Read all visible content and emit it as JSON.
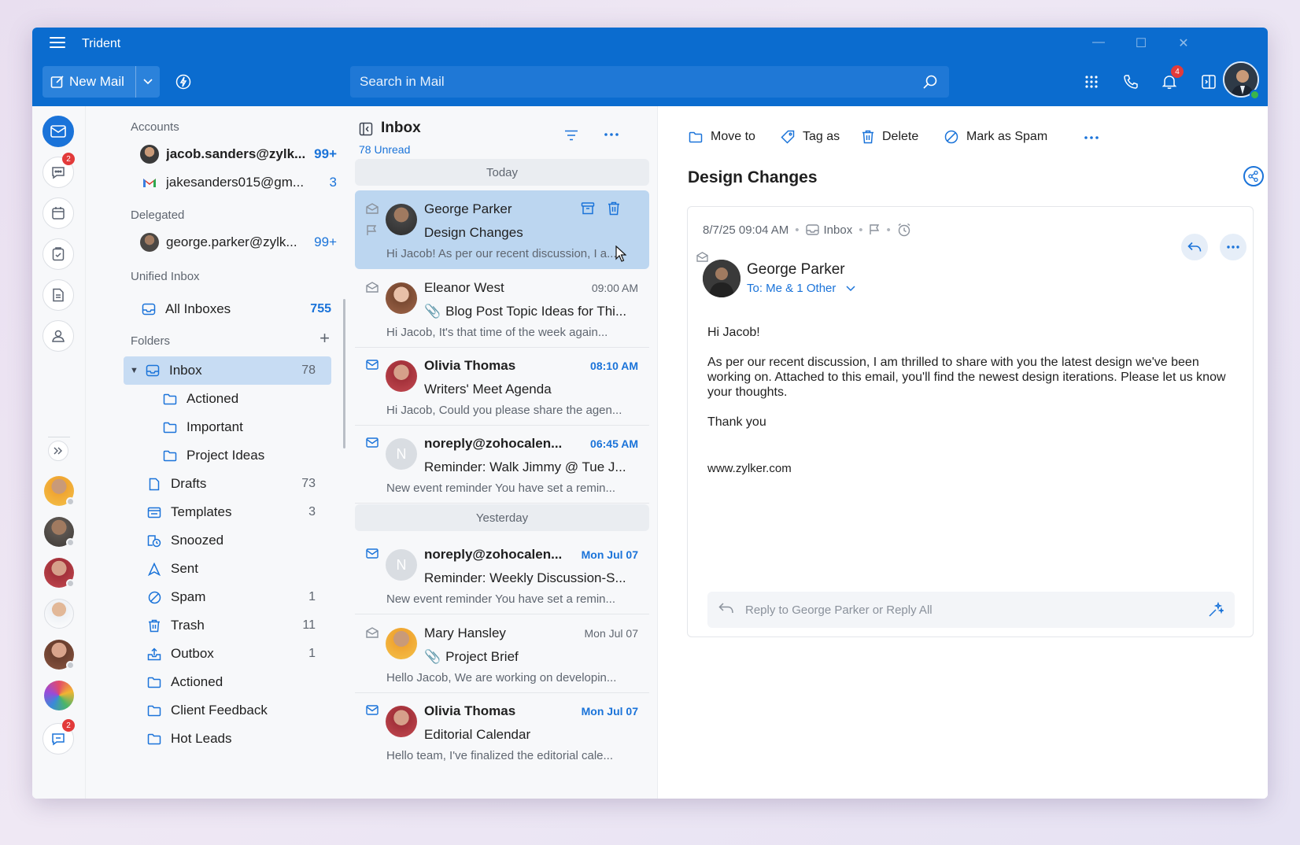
{
  "header": {
    "app_title": "Trident",
    "new_mail_label": "New Mail",
    "search_placeholder": "Search in Mail",
    "notification_count": "4"
  },
  "rail": {
    "chat_badge": "2",
    "bottom_badge": "2"
  },
  "folders": {
    "accounts_title": "Accounts",
    "accounts": [
      {
        "label": "jacob.sanders@zylk...",
        "count": "99+"
      },
      {
        "label": "jakesanders015@gm...",
        "count": "3"
      }
    ],
    "delegated_title": "Delegated",
    "delegated": [
      {
        "label": "george.parker@zylk...",
        "count": "99+"
      }
    ],
    "unified_title": "Unified Inbox",
    "unified": {
      "label": "All Inboxes",
      "count": "755"
    },
    "folders_title": "Folders",
    "items": [
      {
        "label": "Inbox",
        "count": "78"
      },
      {
        "label": "Actioned",
        "count": ""
      },
      {
        "label": "Important",
        "count": ""
      },
      {
        "label": "Project Ideas",
        "count": ""
      },
      {
        "label": "Drafts",
        "count": "73"
      },
      {
        "label": "Templates",
        "count": "3"
      },
      {
        "label": "Snoozed",
        "count": ""
      },
      {
        "label": "Sent",
        "count": ""
      },
      {
        "label": "Spam",
        "count": "1"
      },
      {
        "label": "Trash",
        "count": "11"
      },
      {
        "label": "Outbox",
        "count": "1"
      },
      {
        "label": "Actioned",
        "count": ""
      },
      {
        "label": "Client Feedback",
        "count": ""
      },
      {
        "label": "Hot Leads",
        "count": ""
      }
    ]
  },
  "list": {
    "title": "Inbox",
    "unread": "78 Unread",
    "day_today": "Today",
    "day_yesterday": "Yesterday",
    "messages": [
      {
        "from": "George Parker",
        "time": "",
        "subject": "Design Changes",
        "preview": "Hi Jacob! As per our recent discussion, I a..."
      },
      {
        "from": "Eleanor West",
        "time": "09:00 AM",
        "subject": "Blog Post Topic Ideas for Thi...",
        "preview": "Hi Jacob, It's that time of the week again..."
      },
      {
        "from": "Olivia Thomas",
        "time": "08:10 AM",
        "subject": "Writers' Meet Agenda",
        "preview": "Hi Jacob, Could you please share the agen..."
      },
      {
        "from": "noreply@zohocalen...",
        "time": "06:45 AM",
        "subject": "Reminder: Walk Jimmy @ Tue J...",
        "preview": "New event reminder You have set a remin...",
        "initial": "N"
      },
      {
        "from": "noreply@zohocalen...",
        "time": "Mon Jul 07",
        "subject": "Reminder: Weekly Discussion-S...",
        "preview": "New event reminder You have set a remin...",
        "initial": "N"
      },
      {
        "from": "Mary Hansley",
        "time": "Mon Jul 07",
        "subject": "Project Brief",
        "preview": "Hello Jacob, We are working on developin..."
      },
      {
        "from": "Olivia Thomas",
        "time": "Mon Jul 07",
        "subject": "Editorial Calendar",
        "preview": "Hello team, I've finalized the editorial cale..."
      }
    ]
  },
  "reader": {
    "toolbar": {
      "move_to": "Move to",
      "tag_as": "Tag as",
      "delete": "Delete",
      "mark_spam": "Mark as Spam"
    },
    "subject": "Design Changes",
    "date": "8/7/25 09:04 AM",
    "folder": "Inbox",
    "sender": "George Parker",
    "to": "To: Me & 1 Other",
    "body": {
      "greeting": "Hi Jacob!",
      "paragraph": "As per our recent discussion, I am thrilled to share with you the latest design we've been working on. Attached to this email, you'll find the newest design iterations. Please let us know your thoughts.",
      "closing": "Thank you",
      "link": "www.zylker.com"
    },
    "reply_placeholder": "Reply to George Parker or Reply All"
  },
  "colors": {
    "header": "#0b6ccf",
    "accent": "#1a73d9",
    "selected_row": "#c7dcf3",
    "selected_message": "#bcd6f0"
  }
}
